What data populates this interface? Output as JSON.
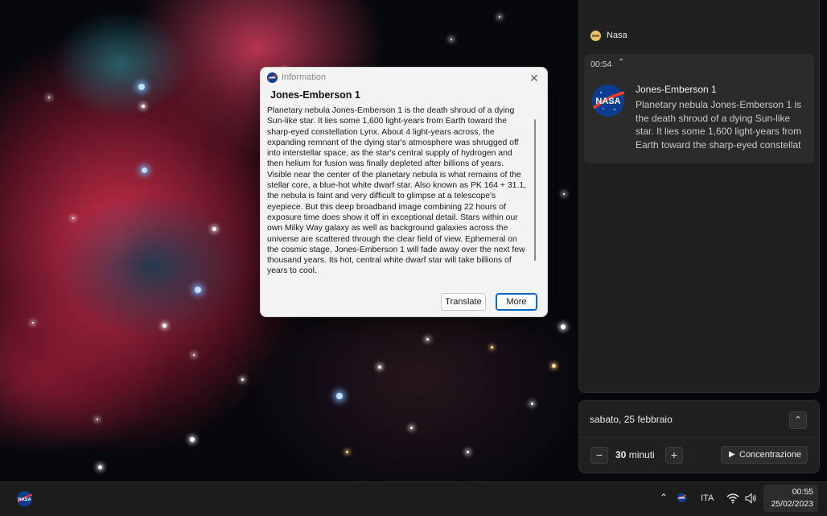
{
  "dialog": {
    "window_title": "Information",
    "heading": "Jones-Emberson 1",
    "body": "Planetary nebula Jones-Emberson 1 is the death shroud of a dying Sun-like star. It lies some 1,600 light-years from Earth toward the sharp-eyed constellation Lynx. About 4 light-years across, the expanding remnant of the dying star's atmosphere was shrugged off into interstellar space, as the star's central supply of hydrogen and then helium for fusion was finally depleted after billions of years. Visible near the center of the planetary nebula is what remains of the stellar core, a blue-hot white dwarf star.  Also known as PK 164 + 31.1, the nebula is faint and very difficult to glimpse at a telescope's eyepiece. But this deep broadband image combining 22 hours of exposure time does show it off in exceptional detail. Stars within our own Milky Way galaxy as well as background galaxies across the universe are scattered through the clear field of view. Ephemeral on the cosmic stage, Jones-Emberson 1 will fade away over the next few thousand years. Its hot, central white dwarf star will take billions of years to cool.",
    "translate_label": "Translate",
    "more_label": "More",
    "close_icon": "close-icon"
  },
  "notification": {
    "app_name": "Nasa",
    "time": "00:54",
    "title": "Jones-Emberson 1",
    "text": "Planetary nebula Jones-Emberson 1 is the death shroud of a dying Sun-like star. It lies some 1,600 light-years from Earth toward the sharp-eyed constellat"
  },
  "calendar": {
    "date": "sabato, 25 febbraio",
    "focus_value": "30",
    "focus_unit": "minuti",
    "focus_start_label": "Concentrazione",
    "minus_label": "−",
    "plus_label": "+"
  },
  "taskbar": {
    "language": "ITA",
    "time": "00:55",
    "date": "25/02/2023"
  },
  "colors": {
    "accent": "#0a67c2",
    "nasa_blue": "#0b3d91",
    "nasa_red": "#fc3d21"
  }
}
